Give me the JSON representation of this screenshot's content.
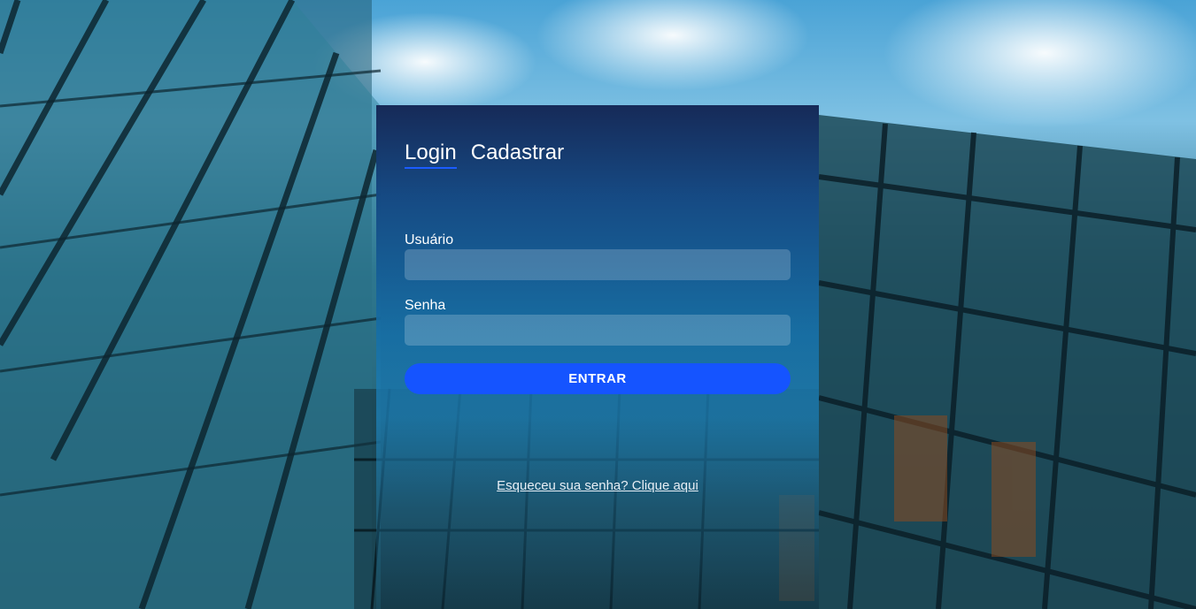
{
  "tabs": {
    "login": "Login",
    "register": "Cadastrar"
  },
  "form": {
    "username_label": "Usuário",
    "username_value": "",
    "password_label": "Senha",
    "password_value": "",
    "submit_label": "ENTRAR"
  },
  "forgot_password": "Esqueceu sua senha? Clique aqui",
  "colors": {
    "accent": "#1554ff",
    "panel_top": "#16295a"
  }
}
